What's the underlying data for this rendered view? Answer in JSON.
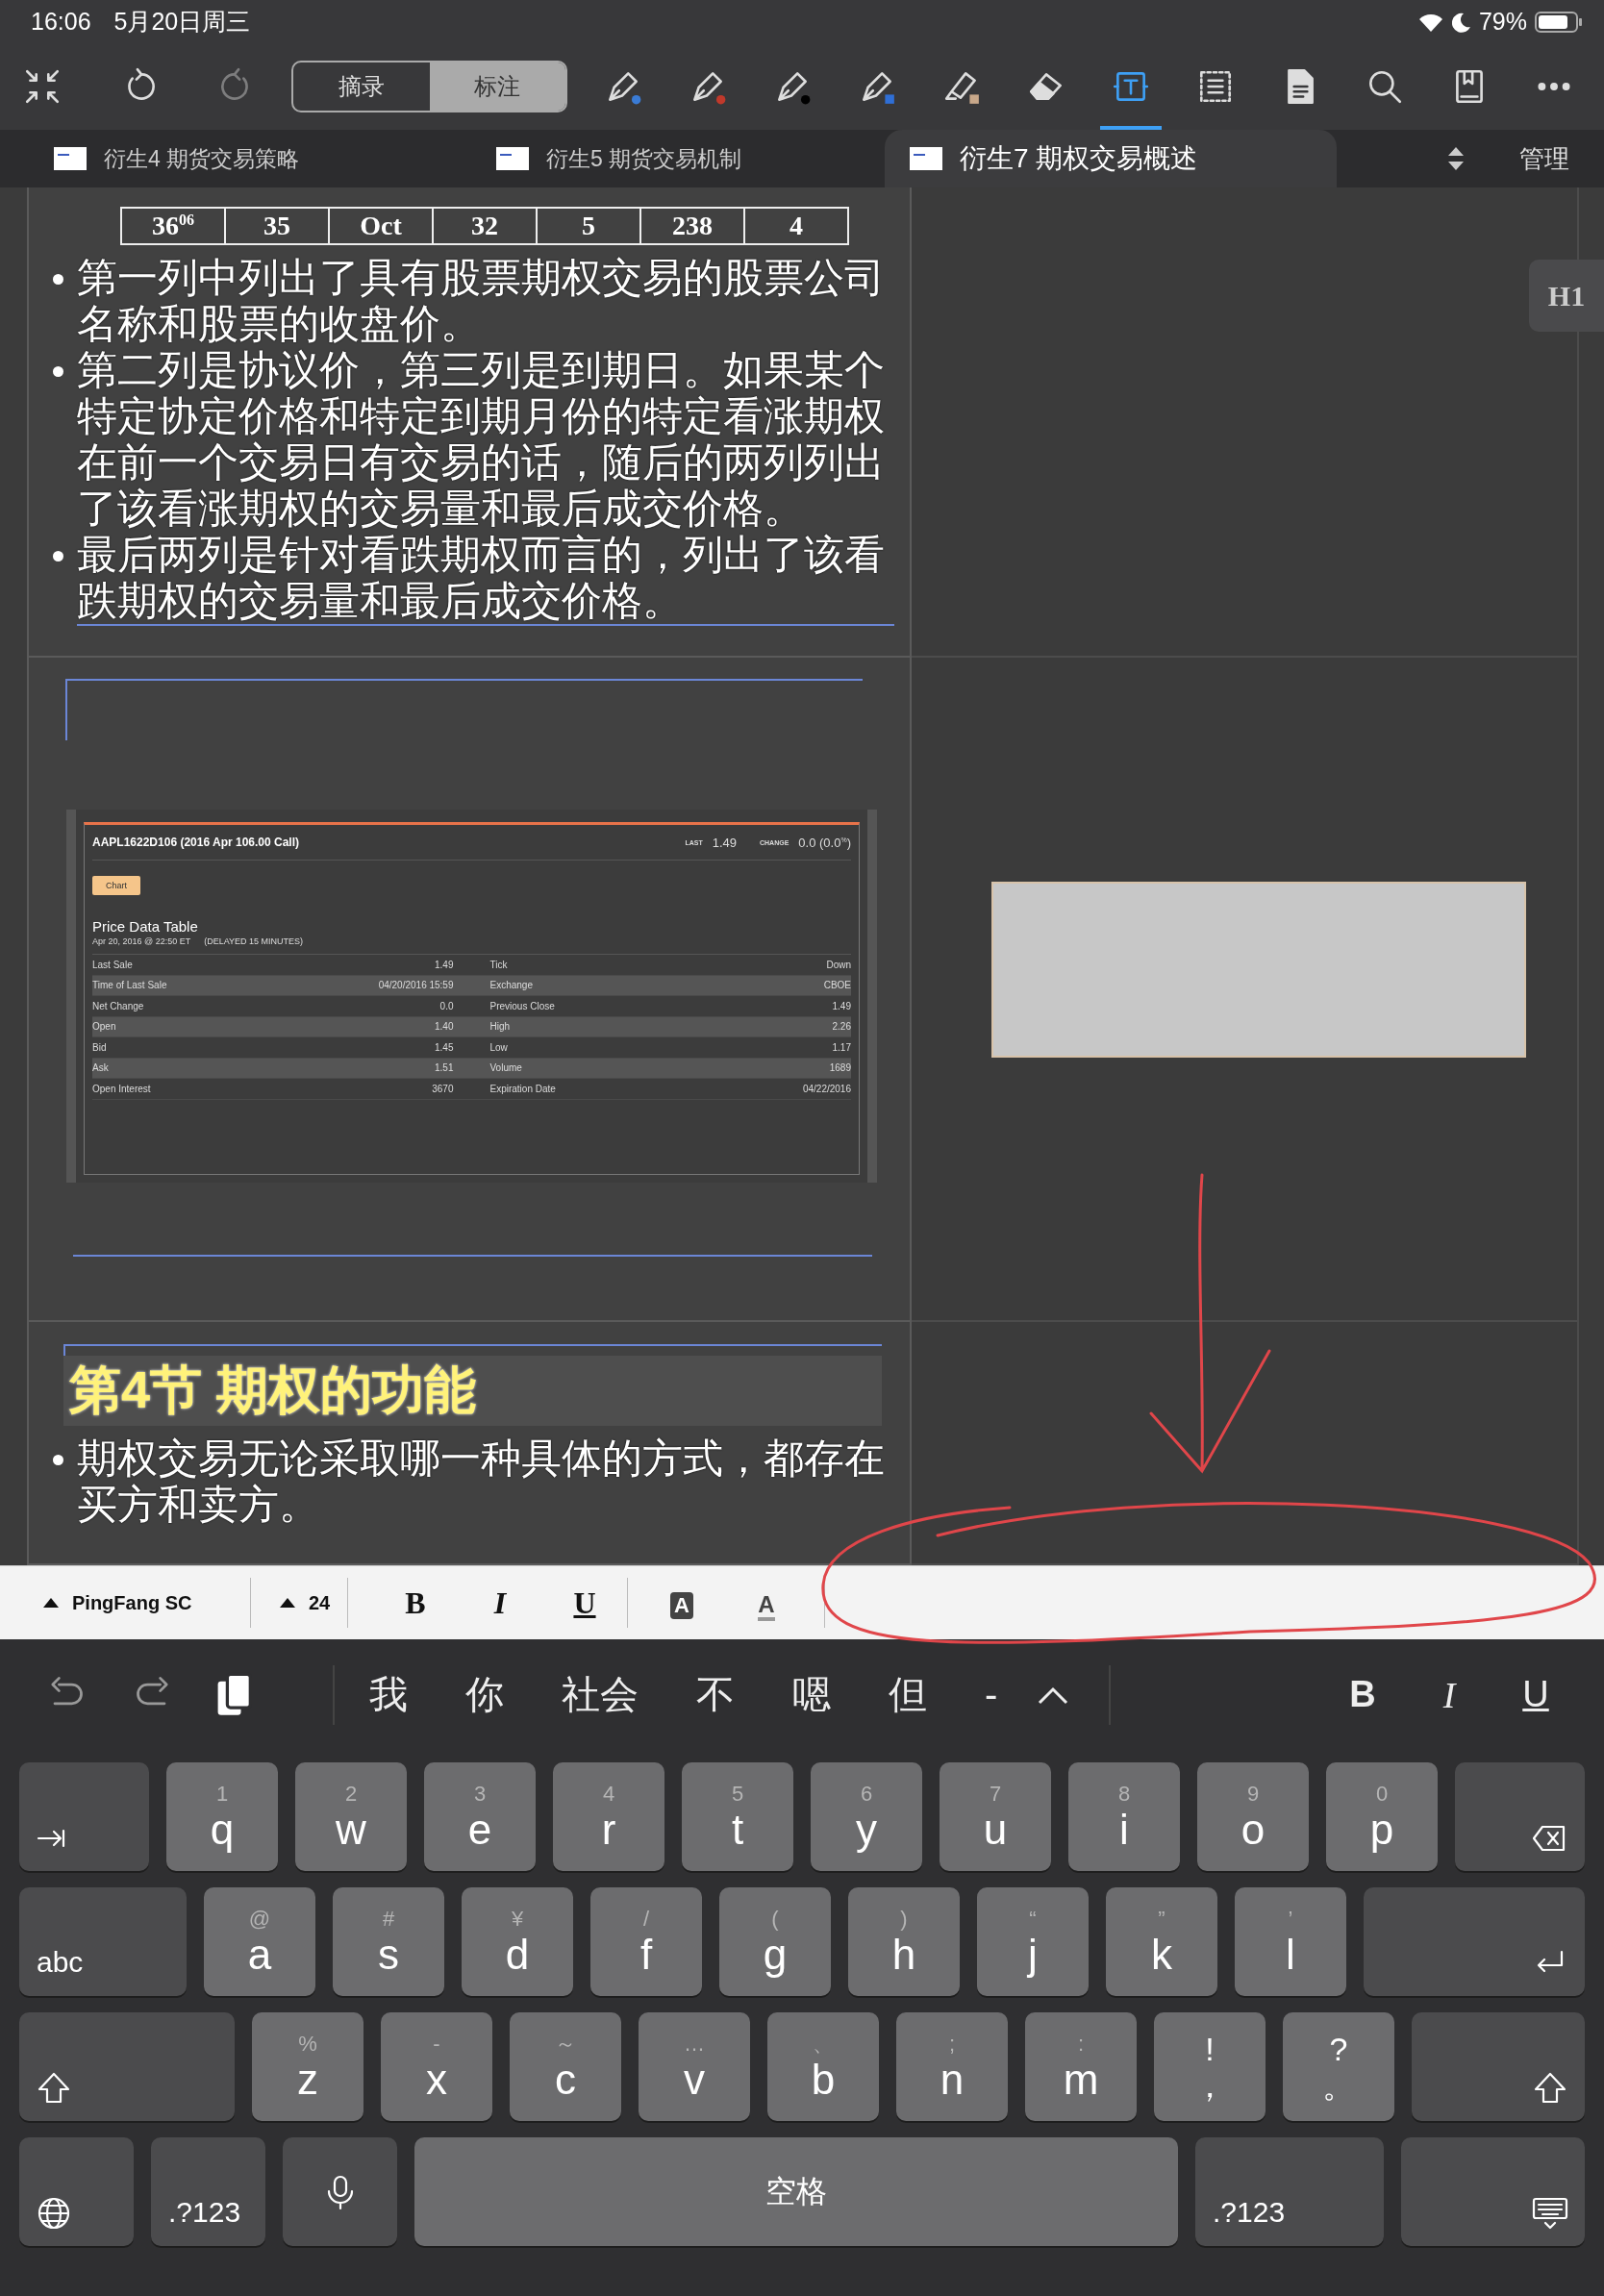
{
  "status_bar": {
    "time": "16:06",
    "date": "5月20日周三",
    "battery": "79%"
  },
  "toolbar": {
    "left_tools": [
      {
        "kind": "collapse",
        "selected": false,
        "disabled": false
      },
      {
        "kind": "undo",
        "selected": false,
        "disabled": false
      },
      {
        "kind": "redo",
        "selected": false,
        "disabled": true
      }
    ],
    "modes": [
      {
        "label": "摘录",
        "selected": false
      },
      {
        "label": "标注",
        "selected": true
      }
    ],
    "tools": [
      {
        "kind": "pen",
        "color": "#3a7bd5",
        "selected": false,
        "disabled": false
      },
      {
        "kind": "pen",
        "color": "#c0392b",
        "selected": false,
        "disabled": false
      },
      {
        "kind": "pen",
        "color": "#000000",
        "selected": false,
        "disabled": false
      },
      {
        "kind": "brush",
        "color": "#2f6fd6",
        "selected": false,
        "disabled": false
      },
      {
        "kind": "highlighter",
        "color": "#c8a88a",
        "selected": false,
        "disabled": false
      },
      {
        "kind": "eraser",
        "selected": false,
        "disabled": false
      },
      {
        "kind": "textbox",
        "selected": true,
        "disabled": false
      },
      {
        "kind": "select",
        "selected": false,
        "disabled": false
      },
      {
        "kind": "document",
        "selected": false,
        "disabled": false
      },
      {
        "kind": "search",
        "selected": false,
        "disabled": false
      },
      {
        "kind": "bookmark",
        "selected": false,
        "disabled": false
      },
      {
        "kind": "more",
        "selected": false,
        "disabled": false
      }
    ]
  },
  "tabs": {
    "items": [
      {
        "label": "衍生4 期货交易策略",
        "selected": false
      },
      {
        "label": "衍生5 期货交易机制",
        "selected": false
      },
      {
        "label": "衍生7 期权交易概述",
        "selected": true
      }
    ],
    "manage": "管理"
  },
  "document": {
    "sections": [
      {
        "kind": "text",
        "table_row": [
          "36$^{06}$",
          "35",
          "Oct",
          "32",
          "5",
          "238",
          "4"
        ],
        "bullets": [
          "第一列中列出了具有股票期权交易的股票公司名称和股票的收盘价。",
          "第二列是协议价，第三列是到期日。如果某个特定协定价格和特定到期月份的特定看涨期权在前一个交易日有交易的话，随后的两列列出了该看涨期权的交易量和最后成交价格。",
          "最后两列是针对看跌期权而言的，列出了该看跌期权的交易量和最后成交价格。"
        ]
      },
      {
        "kind": "quote",
        "quote": {
          "title": "AAPL1622D106 (2016 Apr 106.00 Call)",
          "last_label": "LAST",
          "last": "1.49",
          "change_label": "CHANGE",
          "change": "0.0 (0.0$^{%}$)",
          "chart_button": "Chart",
          "table_title": "Price Data Table",
          "timestamp": "Apr 20, 2016 @ 22:50 ET",
          "delay_note": "(DELAYED 15 MINUTES)",
          "rows": [
            [
              "Last Sale",
              "1.49",
              "Tick",
              "Down"
            ],
            [
              "Time of Last Sale",
              "04/20/2016 15:59",
              "Exchange",
              "CBOE"
            ],
            [
              "Net Change",
              "0.0",
              "Previous Close",
              "1.49"
            ],
            [
              "Open",
              "1.40",
              "High",
              "2.26"
            ],
            [
              "Bid",
              "1.45",
              "Low",
              "1.17"
            ],
            [
              "Ask",
              "1.51",
              "Volume",
              "1689"
            ],
            [
              "Open Interest",
              "3670",
              "Expiration Date",
              "04/22/2016"
            ]
          ]
        }
      },
      {
        "kind": "heading",
        "heading": "第4节 期权的功能",
        "bullets": [
          "期权交易无论采取哪一种具体的方式，都存在买方和卖方。"
        ]
      }
    ],
    "side_button": "H1"
  },
  "format_bar": {
    "font": "PingFang SC",
    "size": "24",
    "styles": [
      {
        "kind": "bold",
        "label": "B"
      },
      {
        "kind": "italic",
        "label": "I"
      },
      {
        "kind": "underline",
        "label": "U"
      },
      {
        "kind": "highlight",
        "label": "A"
      },
      {
        "kind": "text-color",
        "label": "A"
      }
    ]
  },
  "keyboard": {
    "suggestions": [
      "我",
      "你",
      "社会",
      "不",
      "嗯",
      "但",
      "-"
    ],
    "styles": [
      "B",
      "I",
      "U"
    ],
    "rows": [
      {
        "keys": [
          {
            "kind": "tab"
          },
          {
            "kind": "letter",
            "main": "q",
            "alt": "1"
          },
          {
            "kind": "letter",
            "main": "w",
            "alt": "2"
          },
          {
            "kind": "letter",
            "main": "e",
            "alt": "3"
          },
          {
            "kind": "letter",
            "main": "r",
            "alt": "4"
          },
          {
            "kind": "letter",
            "main": "t",
            "alt": "5"
          },
          {
            "kind": "letter",
            "main": "y",
            "alt": "6"
          },
          {
            "kind": "letter",
            "main": "u",
            "alt": "7"
          },
          {
            "kind": "letter",
            "main": "i",
            "alt": "8"
          },
          {
            "kind": "letter",
            "main": "o",
            "alt": "9"
          },
          {
            "kind": "letter",
            "main": "p",
            "alt": "0"
          },
          {
            "kind": "delete"
          }
        ]
      },
      {
        "keys": [
          {
            "kind": "text",
            "label": "abc"
          },
          {
            "kind": "letter",
            "main": "a",
            "alt": "@"
          },
          {
            "kind": "letter",
            "main": "s",
            "alt": "#"
          },
          {
            "kind": "letter",
            "main": "d",
            "alt": "¥"
          },
          {
            "kind": "letter",
            "main": "f",
            "alt": "/"
          },
          {
            "kind": "letter",
            "main": "g",
            "alt": "("
          },
          {
            "kind": "letter",
            "main": "h",
            "alt": ")"
          },
          {
            "kind": "letter",
            "main": "j",
            "alt": "“"
          },
          {
            "kind": "letter",
            "main": "k",
            "alt": "”"
          },
          {
            "kind": "letter",
            "main": "l",
            "alt": "’"
          },
          {
            "kind": "return"
          }
        ]
      },
      {
        "keys": [
          {
            "kind": "shift"
          },
          {
            "kind": "letter",
            "main": "z",
            "alt": "%"
          },
          {
            "kind": "letter",
            "main": "x",
            "alt": "-"
          },
          {
            "kind": "letter",
            "main": "c",
            "alt": "～"
          },
          {
            "kind": "letter",
            "main": "v",
            "alt": "…"
          },
          {
            "kind": "letter",
            "main": "b",
            "alt": "、"
          },
          {
            "kind": "letter",
            "main": "n",
            "alt": ";"
          },
          {
            "kind": "letter",
            "main": "m",
            "alt": ":"
          },
          {
            "kind": "punct",
            "main": "，",
            "alt": "!"
          },
          {
            "kind": "punct",
            "main": "。",
            "alt": "?"
          },
          {
            "kind": "shift"
          }
        ]
      },
      {
        "keys": [
          {
            "kind": "globe"
          },
          {
            "kind": "text",
            "label": ".?123"
          },
          {
            "kind": "mic"
          },
          {
            "kind": "space",
            "label": "空格"
          },
          {
            "kind": "text",
            "label": ".?123"
          },
          {
            "kind": "hide"
          }
        ]
      }
    ]
  }
}
